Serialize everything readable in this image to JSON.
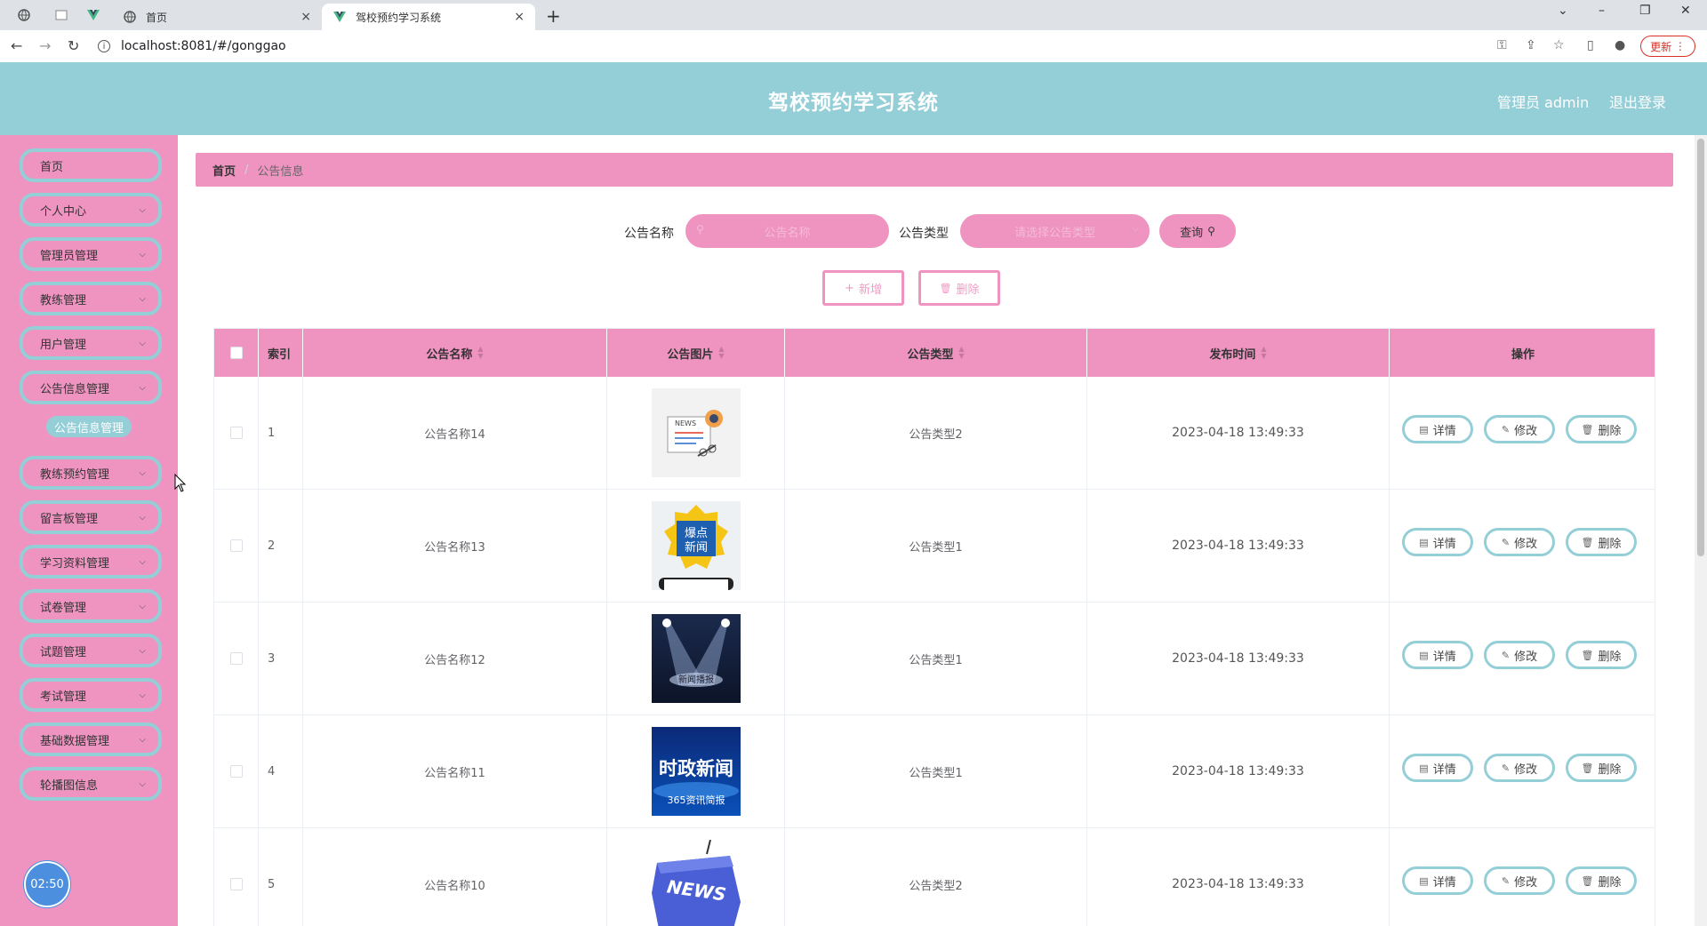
{
  "browser": {
    "tabs": [
      {
        "title": "首页",
        "active": false
      },
      {
        "title": "驾校预约学习系统",
        "active": true
      }
    ],
    "new_tab": "+",
    "close_glyph": "×",
    "url": "localhost:8081/#/gonggao",
    "update_label": "更新"
  },
  "header": {
    "title": "驾校预约学习系统",
    "user_label": "管理员 admin",
    "logout_label": "退出登录"
  },
  "sidebar": {
    "items": [
      {
        "label": "首页",
        "has_children": false
      },
      {
        "label": "个人中心",
        "has_children": true
      },
      {
        "label": "管理员管理",
        "has_children": true
      },
      {
        "label": "教练管理",
        "has_children": true
      },
      {
        "label": "用户管理",
        "has_children": true
      },
      {
        "label": "公告信息管理",
        "has_children": true
      },
      {
        "label": "教练预约管理",
        "has_children": true
      },
      {
        "label": "留言板管理",
        "has_children": true
      },
      {
        "label": "学习资料管理",
        "has_children": true
      },
      {
        "label": "试卷管理",
        "has_children": true
      },
      {
        "label": "试题管理",
        "has_children": true
      },
      {
        "label": "考试管理",
        "has_children": true
      },
      {
        "label": "基础数据管理",
        "has_children": true
      },
      {
        "label": "轮播图信息",
        "has_children": true
      }
    ],
    "active_submenu": "公告信息管理",
    "timer": "02:50"
  },
  "breadcrumb": {
    "home": "首页",
    "separator": "/",
    "current": "公告信息"
  },
  "search": {
    "name_label": "公告名称",
    "name_placeholder": "公告名称",
    "type_label": "公告类型",
    "type_placeholder": "请选择公告类型",
    "query_label": "查询"
  },
  "toolbar": {
    "add_label": "新增",
    "delete_label": "删除"
  },
  "table": {
    "columns": [
      "索引",
      "公告名称",
      "公告图片",
      "公告类型",
      "发布时间",
      "操作"
    ],
    "rows": [
      {
        "index": "1",
        "name": "公告名称14",
        "image": "news-illustration",
        "type": "公告类型2",
        "time": "2023-04-18 13:49:33"
      },
      {
        "index": "2",
        "name": "公告名称13",
        "image": "hot-news-phone",
        "type": "公告类型1",
        "time": "2023-04-18 13:49:33"
      },
      {
        "index": "3",
        "name": "公告名称12",
        "image": "spotlight-stage",
        "type": "公告类型1",
        "time": "2023-04-18 13:49:33"
      },
      {
        "index": "4",
        "name": "公告名称11",
        "image": "politics-news-banner",
        "type": "公告类型1",
        "time": "2023-04-18 13:49:33"
      },
      {
        "index": "5",
        "name": "公告名称10",
        "image": "news-key",
        "type": "公告类型2",
        "time": "2023-04-18 13:49:33"
      }
    ],
    "actions": {
      "detail": "详情",
      "edit": "修改",
      "delete": "删除"
    }
  },
  "images": {
    "img2_text": "爆点新闻",
    "img3_text": "新闻播报",
    "img4_text_top": "时政新闻",
    "img4_text_bottom": "365资讯简报",
    "img5_text": "NEWS",
    "img1_text": "NEWS"
  },
  "colors": {
    "accent_teal": "#94ced7",
    "accent_pink": "#ef93c1",
    "timer_blue": "#4b8fde"
  }
}
